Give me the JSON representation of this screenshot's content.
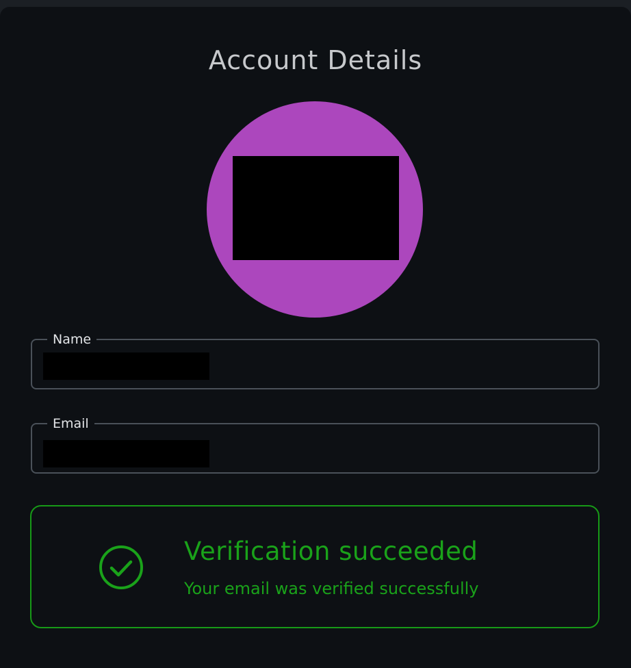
{
  "header": {
    "title": "Account Details"
  },
  "avatar": {
    "background_color": "#ac47bd",
    "content": "redacted"
  },
  "fields": {
    "name": {
      "label": "Name",
      "value": "redacted"
    },
    "email": {
      "label": "Email",
      "value": "redacted"
    }
  },
  "verification": {
    "status": "success",
    "icon": "check-circle-icon",
    "title": "Verification succeeded",
    "message": "Your email was verified successfully",
    "color": "#1aa21a"
  },
  "colors": {
    "page_background": "#0d1014",
    "field_border": "#4a5159",
    "success_border": "#179a17"
  }
}
